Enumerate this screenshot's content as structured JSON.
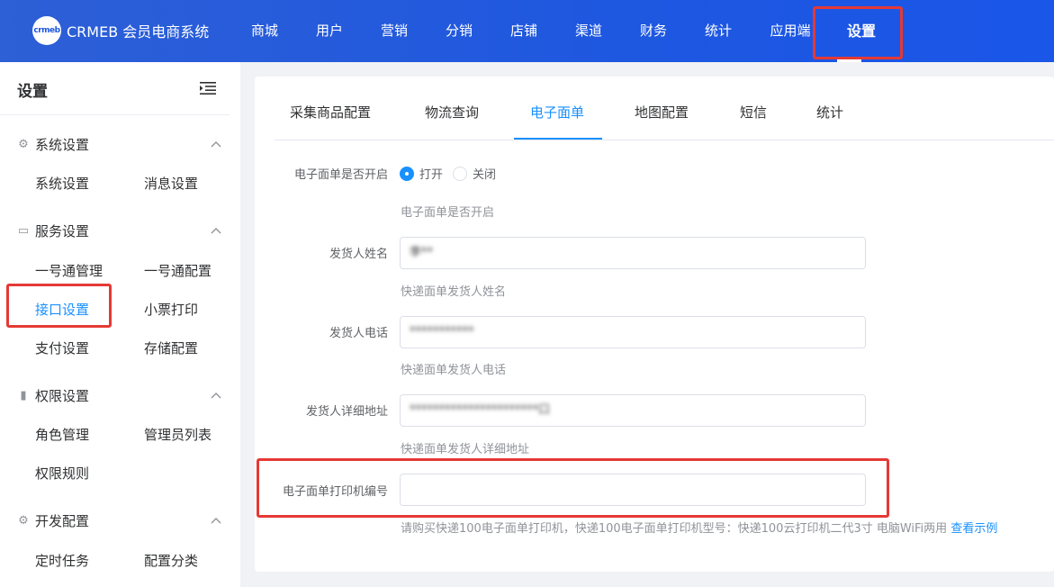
{
  "brand": {
    "badge": "crmeb",
    "name": "CRMEB 会员电商系统"
  },
  "nav": [
    {
      "label": "商城"
    },
    {
      "label": "用户"
    },
    {
      "label": "营销"
    },
    {
      "label": "分销"
    },
    {
      "label": "店铺"
    },
    {
      "label": "渠道"
    },
    {
      "label": "财务"
    },
    {
      "label": "统计"
    },
    {
      "label": "应用端"
    },
    {
      "label": "设置",
      "active": true
    }
  ],
  "sidebar": {
    "title": "设置",
    "groups": [
      {
        "label": "系统设置",
        "items": [
          "系统设置",
          "消息设置"
        ]
      },
      {
        "label": "服务设置",
        "items": [
          "一号通管理",
          "一号通配置",
          "接口设置",
          "小票打印",
          "支付设置",
          "存储配置"
        ]
      },
      {
        "label": "权限设置",
        "items": [
          "角色管理",
          "管理员列表",
          "权限规则"
        ]
      },
      {
        "label": "开发配置",
        "items": [
          "定时任务",
          "配置分类"
        ]
      }
    ],
    "active_item": "接口设置"
  },
  "tabs": [
    "采集商品配置",
    "物流查询",
    "电子面单",
    "地图配置",
    "短信",
    "统计"
  ],
  "active_tab": "电子面单",
  "form": {
    "enable": {
      "label": "电子面单是否开启",
      "options": [
        "打开",
        "关闭"
      ],
      "selected": "打开",
      "hint": "电子面单是否开启"
    },
    "sender_name": {
      "label": "发货人姓名",
      "value": "李**",
      "hint": "快递面单发货人姓名"
    },
    "sender_phone": {
      "label": "发货人电话",
      "value": "***********",
      "hint": "快递面单发货人电话"
    },
    "sender_address": {
      "label": "发货人详细地址",
      "value": "**********************口",
      "hint": "快递面单发货人详细地址"
    },
    "printer_id": {
      "label": "电子面单打印机编号",
      "value": "",
      "hint": "请购买快递100电子面单打印机，快递100电子面单打印机型号：快递100云打印机二代3寸 电脑WiFi两用",
      "hint_link": "查看示例"
    }
  },
  "colors": {
    "primary": "#1890ff",
    "topbar": "#1e57e0",
    "annotation": "#e53935"
  }
}
